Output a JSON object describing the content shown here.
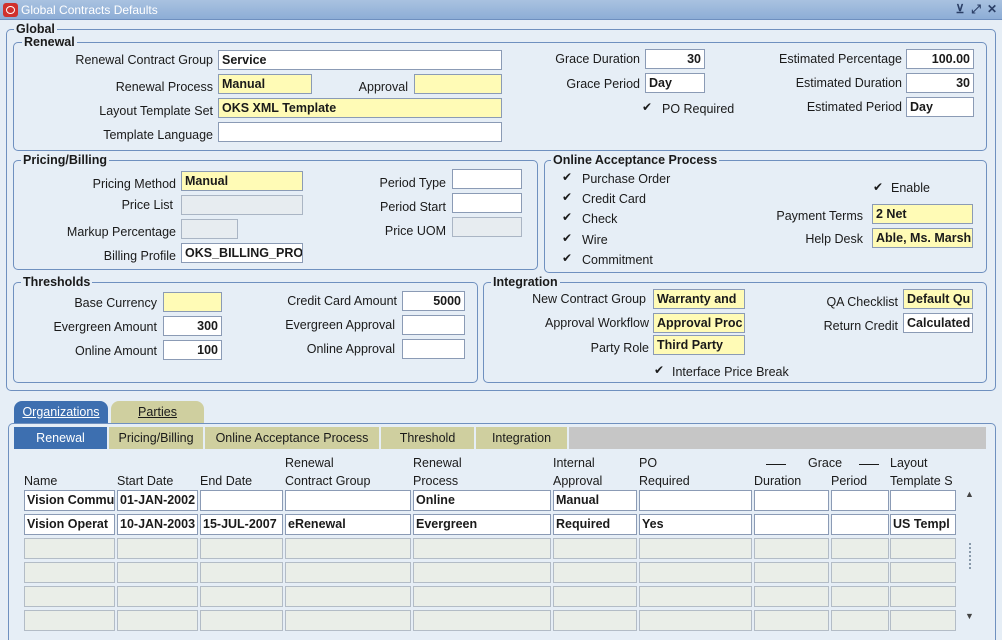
{
  "window": {
    "title": "Global Contracts Defaults",
    "controls": [
      "minimize-icon",
      "maximize-icon",
      "close-icon"
    ]
  },
  "global_legend": "Global",
  "renewal": {
    "legend": "Renewal",
    "contract_group_label": "Renewal Contract Group",
    "contract_group_value": "Service",
    "process_label": "Renewal Process",
    "process_value": "Manual",
    "approval_label": "Approval",
    "approval_value": "",
    "layout_label": "Layout Template Set",
    "layout_value": "OKS XML Template",
    "language_label": "Template Language",
    "language_value": "",
    "grace_duration_label": "Grace Duration",
    "grace_duration_value": "30",
    "grace_period_label": "Grace Period",
    "grace_period_value": "Day",
    "po_required_label": "PO Required",
    "po_required_checked": true,
    "est_percentage_label": "Estimated Percentage",
    "est_percentage_value": "100.00",
    "est_duration_label": "Estimated Duration",
    "est_duration_value": "30",
    "est_period_label": "Estimated Period",
    "est_period_value": "Day"
  },
  "pricing": {
    "legend": "Pricing/Billing",
    "method_label": "Pricing Method",
    "method_value": "Manual",
    "price_list_label": "Price List",
    "price_list_value": "",
    "markup_label": "Markup Percentage",
    "markup_value": "",
    "billing_label": "Billing Profile",
    "billing_value": "OKS_BILLING_PRO",
    "period_type_label": "Period Type",
    "period_type_value": "",
    "period_start_label": "Period Start",
    "period_start_value": "",
    "price_uom_label": "Price UOM",
    "price_uom_value": ""
  },
  "online": {
    "legend": "Online Acceptance Process",
    "options": [
      {
        "label": "Purchase Order",
        "checked": true
      },
      {
        "label": "Credit Card",
        "checked": true
      },
      {
        "label": "Check",
        "checked": true
      },
      {
        "label": "Wire",
        "checked": true
      },
      {
        "label": "Commitment",
        "checked": true
      }
    ],
    "enable_label": "Enable",
    "enable_checked": true,
    "payment_terms_label": "Payment Terms",
    "payment_terms_value": "2 Net",
    "help_desk_label": "Help Desk",
    "help_desk_value": "Able, Ms. Marsh"
  },
  "thresholds": {
    "legend": "Thresholds",
    "base_currency_label": "Base Currency",
    "base_currency_value": "",
    "evergreen_amount_label": "Evergreen Amount",
    "evergreen_amount_value": "300",
    "online_amount_label": "Online Amount",
    "online_amount_value": "100",
    "cc_amount_label": "Credit Card Amount",
    "cc_amount_value": "5000",
    "evergreen_approval_label": "Evergreen Approval",
    "evergreen_approval_value": "",
    "online_approval_label": "Online Approval",
    "online_approval_value": ""
  },
  "integration": {
    "legend": "Integration",
    "new_group_label": "New Contract Group",
    "new_group_value": "Warranty and",
    "workflow_label": "Approval Workflow",
    "workflow_value": "Approval Proc",
    "party_role_label": "Party Role",
    "party_role_value": "Third Party",
    "qa_label": "QA Checklist",
    "qa_value": "Default Qu",
    "return_credit_label": "Return Credit",
    "return_credit_value": "Calculated",
    "price_break_label": "Interface Price Break",
    "price_break_checked": true
  },
  "tabs": [
    {
      "label": "Organizations",
      "active": true
    },
    {
      "label": "Parties",
      "active": false
    }
  ],
  "subtabs": [
    {
      "label": "Renewal",
      "active": true
    },
    {
      "label": "Pricing/Billing",
      "active": false
    },
    {
      "label": "Online Acceptance Process",
      "active": false
    },
    {
      "label": "Threshold",
      "active": false
    },
    {
      "label": "Integration",
      "active": false
    }
  ],
  "table": {
    "headers": {
      "name": "Name",
      "start": "Start Date",
      "end": "End Date",
      "renewal_top": "Renewal",
      "group": "Contract Group",
      "renewal_top2": "Renewal",
      "process": "Process",
      "internal_top": "Internal",
      "approval": "Approval",
      "po_top": "PO",
      "required": "Required",
      "grace": "Grace",
      "duration": "Duration",
      "period": "Period",
      "layout_top": "Layout",
      "template": "Template S"
    },
    "rows": [
      [
        "Vision Commu",
        "01-JAN-2002",
        "",
        "",
        "Online",
        "Manual",
        "",
        "",
        "",
        ""
      ],
      [
        "Vision Operat",
        "10-JAN-2003",
        "15-JUL-2007",
        "eRenewal",
        "Evergreen",
        "Required",
        "Yes",
        "",
        "",
        "US Templ"
      ],
      [
        "",
        "",
        "",
        "",
        "",
        "",
        "",
        "",
        "",
        ""
      ],
      [
        "",
        "",
        "",
        "",
        "",
        "",
        "",
        "",
        "",
        ""
      ],
      [
        "",
        "",
        "",
        "",
        "",
        "",
        "",
        "",
        "",
        ""
      ],
      [
        "",
        "",
        "",
        "",
        "",
        "",
        "",
        "",
        "",
        ""
      ]
    ]
  }
}
